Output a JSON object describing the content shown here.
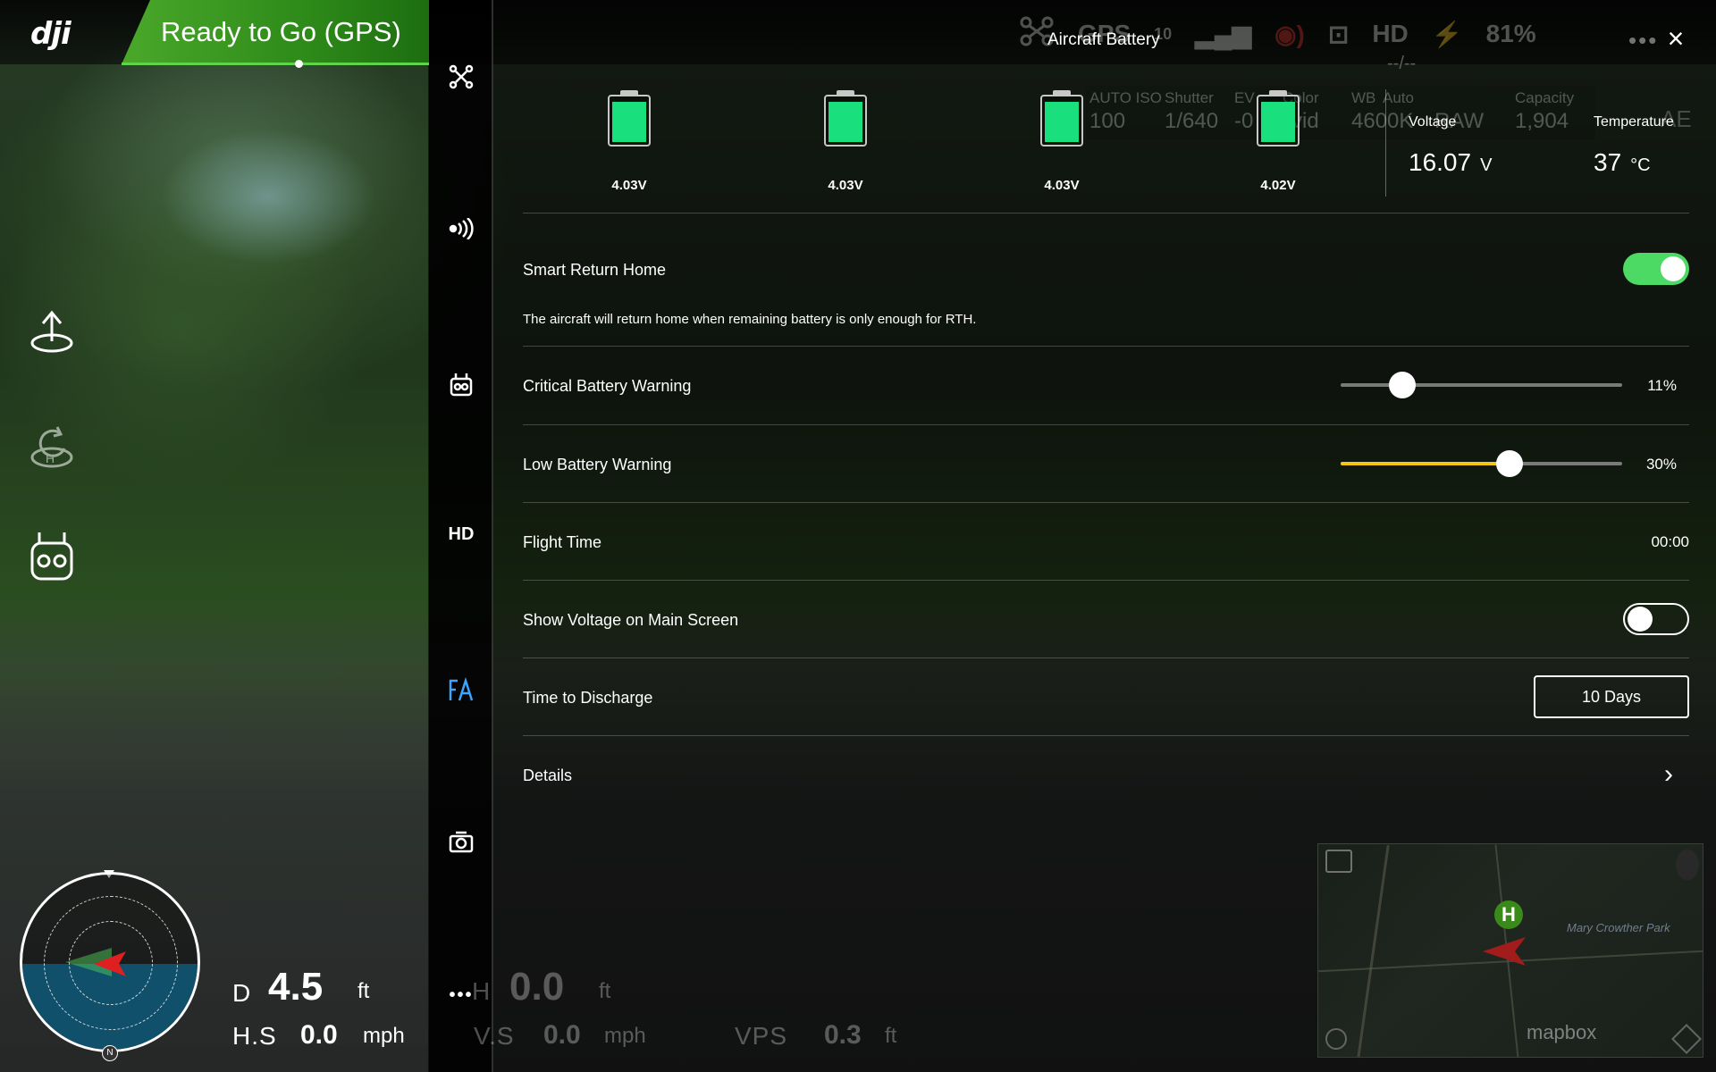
{
  "status": {
    "label": "Ready to Go (GPS)"
  },
  "top_bar": {
    "gps_label": "GPS",
    "satellites": "10",
    "hd_label": "HD",
    "battery_percent": "81%",
    "more_dots": "•••"
  },
  "panel": {
    "title": "Aircraft Battery",
    "close_icon": "×"
  },
  "camera_params": {
    "auto_iso_label": "AUTO ISO",
    "iso_value": "100",
    "shutter_label": "Shutter",
    "shutter_value": "1/640",
    "ev_label": "EV",
    "ev_value": "-0",
    "color_label": "Color",
    "color_value": "vid",
    "wb_label": "WB",
    "wb_mode": "Auto",
    "wb_value": "4600K",
    "format_value": "RAW",
    "capacity_label": "Capacity",
    "capacity_value": "1,904",
    "ae_label": "AE",
    "center_value": "--/--"
  },
  "battery": {
    "cells": [
      {
        "voltage": "4.03V",
        "level": 1.0
      },
      {
        "voltage": "4.03V",
        "level": 1.0
      },
      {
        "voltage": "4.03V",
        "level": 1.0
      },
      {
        "voltage": "4.02V",
        "level": 1.0
      }
    ],
    "voltage_label": "Voltage",
    "voltage_value": "16.07",
    "voltage_unit": "V",
    "temperature_label": "Temperature",
    "temperature_value": "37",
    "temperature_unit": "°C"
  },
  "settings": {
    "smart_rth_label": "Smart Return Home",
    "smart_rth_on": true,
    "smart_rth_desc": "The aircraft will return home when remaining battery is only enough for RTH.",
    "critical_label": "Critical Battery Warning",
    "critical_value": "11%",
    "critical_level": 0.11,
    "low_label": "Low Battery Warning",
    "low_value": "30%",
    "low_level": 0.3,
    "flight_time_label": "Flight Time",
    "flight_time_value": "00:00",
    "show_voltage_label": "Show Voltage on Main Screen",
    "show_voltage_on": false,
    "discharge_label": "Time to Discharge",
    "discharge_value": "10 Days",
    "details_label": "Details",
    "chevron": "›"
  },
  "nav": {
    "hd_label": "HD",
    "more_label": "•••"
  },
  "telemetry": {
    "d_label": "D",
    "d_value": "4.5",
    "d_unit": "ft",
    "h_label": "H",
    "h_value": "0.0",
    "h_unit": "ft",
    "hs_label": "H.S",
    "hs_value": "0.0",
    "hs_unit": "mph",
    "vs_label": "V.S",
    "vs_value": "0.0",
    "vs_unit": "mph",
    "vps_label": "VPS",
    "vps_value": "0.3",
    "vps_unit": "ft"
  },
  "compass": {
    "north_label": "N"
  },
  "map": {
    "park_label": "Mary Crowther Park",
    "logo": "mapbox",
    "home_label": "H"
  },
  "colors": {
    "status_green": "#2e8a19",
    "cell_green": "#19e07c",
    "toggle_green": "#4cd964",
    "slider_yellow": "#f5c518",
    "nav_active_blue": "#3aa6ff"
  }
}
